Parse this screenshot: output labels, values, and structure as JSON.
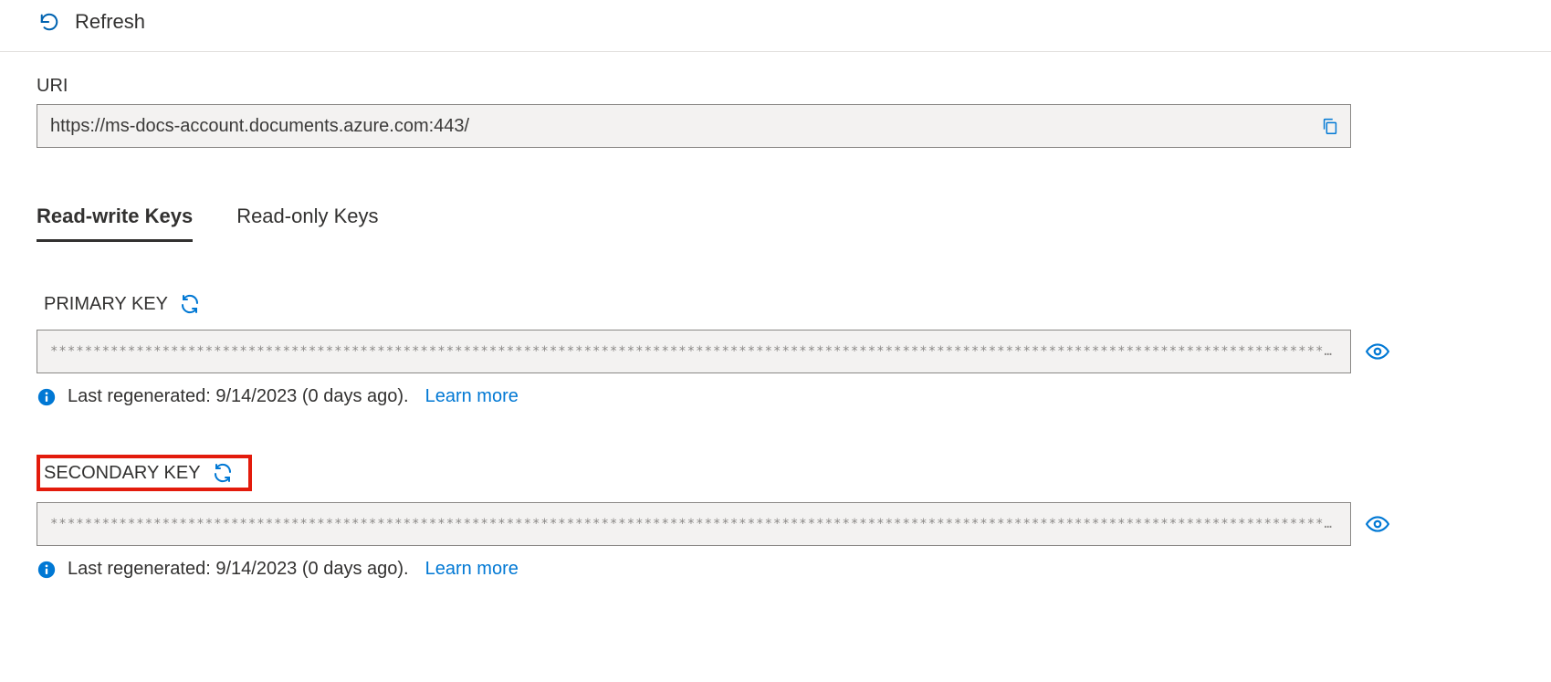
{
  "toolbar": {
    "refresh_label": "Refresh"
  },
  "uri": {
    "label": "URI",
    "value": "https://ms-docs-account.documents.azure.com:443/"
  },
  "tabs": {
    "read_write": "Read-write Keys",
    "read_only": "Read-only Keys",
    "active": "read_write"
  },
  "primary_key": {
    "label": "PRIMARY KEY",
    "masked_value": "**********************************************************************************************************************************************************************",
    "status": "Last regenerated: 9/14/2023 (0 days ago).",
    "learn_more": "Learn more"
  },
  "secondary_key": {
    "label": "SECONDARY KEY",
    "masked_value": "**********************************************************************************************************************************************************************",
    "status": "Last regenerated: 9/14/2023 (0 days ago).",
    "learn_more": "Learn more"
  },
  "colors": {
    "accent": "#0078d4",
    "highlight_border": "#e31b0c",
    "text": "#323130",
    "field_bg": "#f3f2f1",
    "border": "#8a8886"
  }
}
